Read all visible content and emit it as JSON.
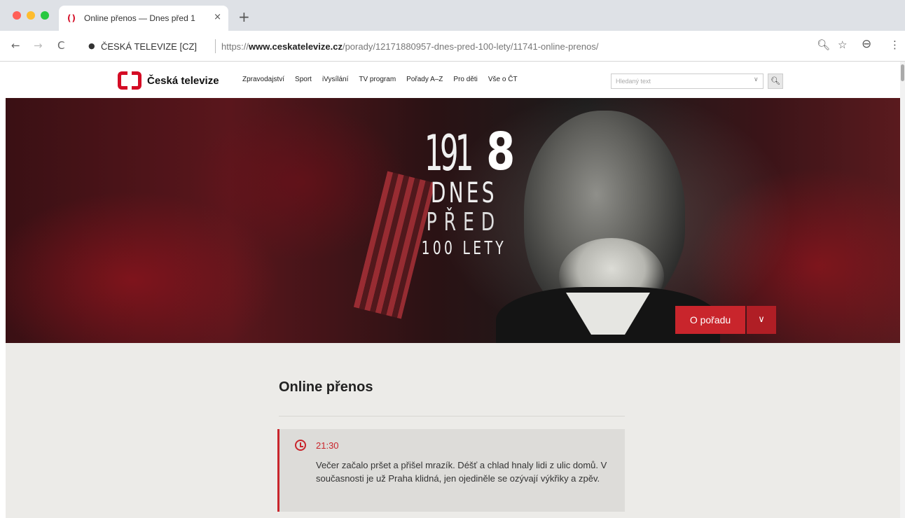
{
  "browser": {
    "tab": {
      "favicon": "()",
      "title": "Online přenos — Dnes před 1 ",
      "close": "×"
    },
    "new_tab": "+",
    "nav": {
      "back": "←",
      "forward": "→",
      "reload": "C"
    },
    "lock": "●",
    "site_identity": "ČESKÁ TELEVIZE [CZ]",
    "url_scheme": "https://",
    "url_host": "www.ceskatelevize.cz",
    "url_path": "/porady/12171880957-dnes-pred-100-lety/11741-online-prenos/",
    "icons": {
      "zoom": "🔍︎",
      "star": "☆",
      "profile": "⊖",
      "menu": "⋮"
    }
  },
  "site": {
    "logo_text": "Česká televize",
    "nav": [
      "Zpravodajství",
      "Sport",
      "iVysílání",
      "TV program",
      "Pořady A–Z",
      "Pro děti",
      "Vše o ČT"
    ],
    "search_placeholder": "Hledaný text",
    "search_dropdown": "∨",
    "search_button": "🔍︎"
  },
  "hero": {
    "year_thin": "191",
    "year_bold": "8",
    "line_dnes": "DNES",
    "line_pred": "PŘED",
    "line_100": "100 LETY",
    "about_button": "O pořadu",
    "about_dropdown": "∨"
  },
  "content": {
    "section_title": "Online přenos",
    "entries": [
      {
        "time": "21:30",
        "text": "Večer začalo pršet a přišel mrazík. Déšť a chlad hnaly lidi z ulic domů. V současnosti je už Praha klidná, jen ojediněle se ozývají výkřiky a zpěv."
      }
    ]
  },
  "colors": {
    "brand_red": "#d40c25",
    "accent_red": "#c9252c",
    "content_bg": "#ecebe8"
  }
}
